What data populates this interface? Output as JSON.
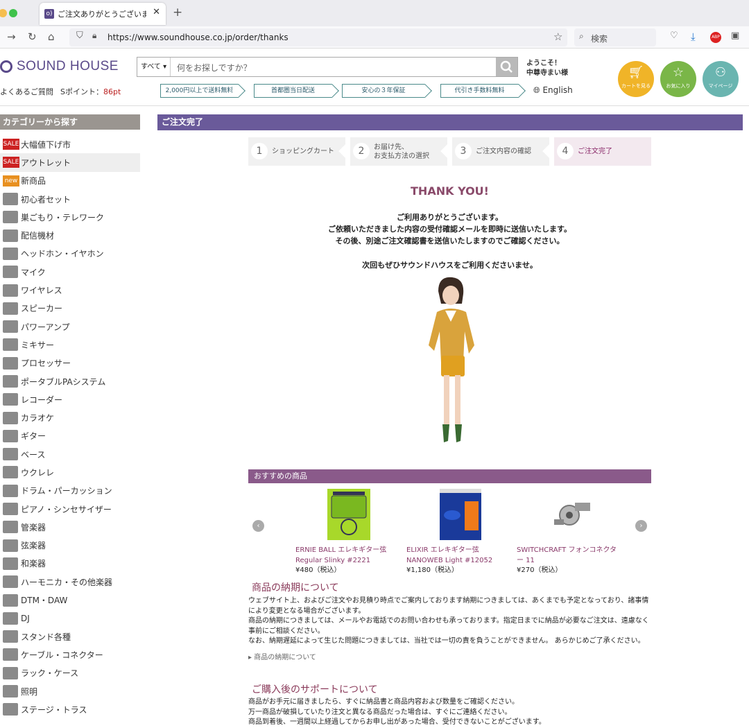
{
  "browser": {
    "tab_title": "ご注文ありがとうございました",
    "url": "https://www.soundhouse.co.jp/order/thanks",
    "search_placeholder": "検索",
    "favicon_text": "o)"
  },
  "header": {
    "logo_text": "SOUND HOUSE",
    "faq": "よくあるご質問",
    "points_label": "Sポイント：",
    "points_value": "86pt",
    "search_category": "すべて ▾",
    "search_placeholder": "何をお探しですか？",
    "welcome_line1": "ようこそ！",
    "welcome_line2": "中尊寺まい様",
    "cart_label": "カートを見る",
    "favorites_label": "お気に入り",
    "mypage_label": "マイページ",
    "banners": [
      "2,000円以上で送料無料",
      "首都圏当日配送",
      "安心の３年保証",
      "代引き手数料無料"
    ],
    "language": "English"
  },
  "sidebar": {
    "title": "カテゴリーから探す",
    "items": [
      {
        "label": "大幅値下げ市",
        "badge": "SALE"
      },
      {
        "label": "アウトレット",
        "badge": "SALE"
      },
      {
        "label": "新商品",
        "badge": "new"
      },
      {
        "label": "初心者セット"
      },
      {
        "label": "巣ごもり・テレワーク"
      },
      {
        "label": "配信機材"
      },
      {
        "label": "ヘッドホン・イヤホン"
      },
      {
        "label": "マイク"
      },
      {
        "label": "ワイヤレス"
      },
      {
        "label": "スピーカー"
      },
      {
        "label": "パワーアンプ"
      },
      {
        "label": "ミキサー"
      },
      {
        "label": "プロセッサー"
      },
      {
        "label": "ポータブルPAシステム"
      },
      {
        "label": "レコーダー"
      },
      {
        "label": "カラオケ"
      },
      {
        "label": "ギター"
      },
      {
        "label": "ベース"
      },
      {
        "label": "ウクレレ"
      },
      {
        "label": "ドラム・パーカッション"
      },
      {
        "label": "ピアノ・シンセサイザー"
      },
      {
        "label": "管楽器"
      },
      {
        "label": "弦楽器"
      },
      {
        "label": "和楽器"
      },
      {
        "label": "ハーモニカ・その他楽器"
      },
      {
        "label": "DTM・DAW"
      },
      {
        "label": "DJ"
      },
      {
        "label": "スタンド各種"
      },
      {
        "label": "ケーブル・コネクター"
      },
      {
        "label": "ラック・ケース"
      },
      {
        "label": "照明"
      },
      {
        "label": "ステージ・トラス"
      }
    ]
  },
  "main": {
    "title": "ご注文完了",
    "steps": [
      {
        "num": "1",
        "label": "ショッピングカート"
      },
      {
        "num": "2",
        "label": "お届け先、\nお支払方法の選択"
      },
      {
        "num": "3",
        "label": "ご注文内容の確認"
      },
      {
        "num": "4",
        "label": "ご注文完了"
      }
    ],
    "thank_you": "THANK YOU!",
    "message_1": "ご利用ありがとうございます。",
    "message_2": "ご依頼いただきました内容の受付確認メールを即時に送信いたします。",
    "message_3": "その後、別途ご注文確認書を送信いたしますのでご確認ください。",
    "message_4": "次回もぜひサウンドハウスをご利用くださいませ。"
  },
  "recommend": {
    "title": "おすすめの商品",
    "products": [
      {
        "name": "ERNIE BALL エレキギター弦 Regular Slinky #2221",
        "price": "¥480（税込）"
      },
      {
        "name": "ELIXIR エレキギター弦 NANOWEB Light #12052",
        "price": "¥1,180（税込）"
      },
      {
        "name": "SWITCHCRAFT フォンコネクター 11",
        "price": "¥270（税込）"
      }
    ]
  },
  "delivery": {
    "heading": "商品の納期について",
    "p1": "ウェブサイト上、およびご注文やお見積り時点でご案内しております納期につきましては、あくまでも予定となっており、諸事情により変更となる場合がございます。",
    "p2": "商品の納期につきましては、メールやお電話でのお問い合わせも承っております。指定日までに納品が必要なご注文は、遠慮なく事前にご相談ください。",
    "p3": "なお、納期遅延によって生じた問題につきましては、当社では一切の責を負うことができません。 あらかじめご了承ください。",
    "link": "商品の納期について"
  },
  "support": {
    "heading": "ご購入後のサポートについて",
    "p1": "商品がお手元に届きましたら、すぐに納品書と商品内容および数量をご確認ください。",
    "p2": "万一商品が破損していたり注文と異なる商品だった場合は、すぐにご連絡ください。",
    "p3": "商品到着後、一週間以上経過してからお申し出があった場合、受付できないことがございます。"
  },
  "colors": {
    "brand": "#5a4a8a",
    "cart": "#f0b428",
    "favorites": "#7ab648",
    "mypage": "#6ab5b0"
  }
}
